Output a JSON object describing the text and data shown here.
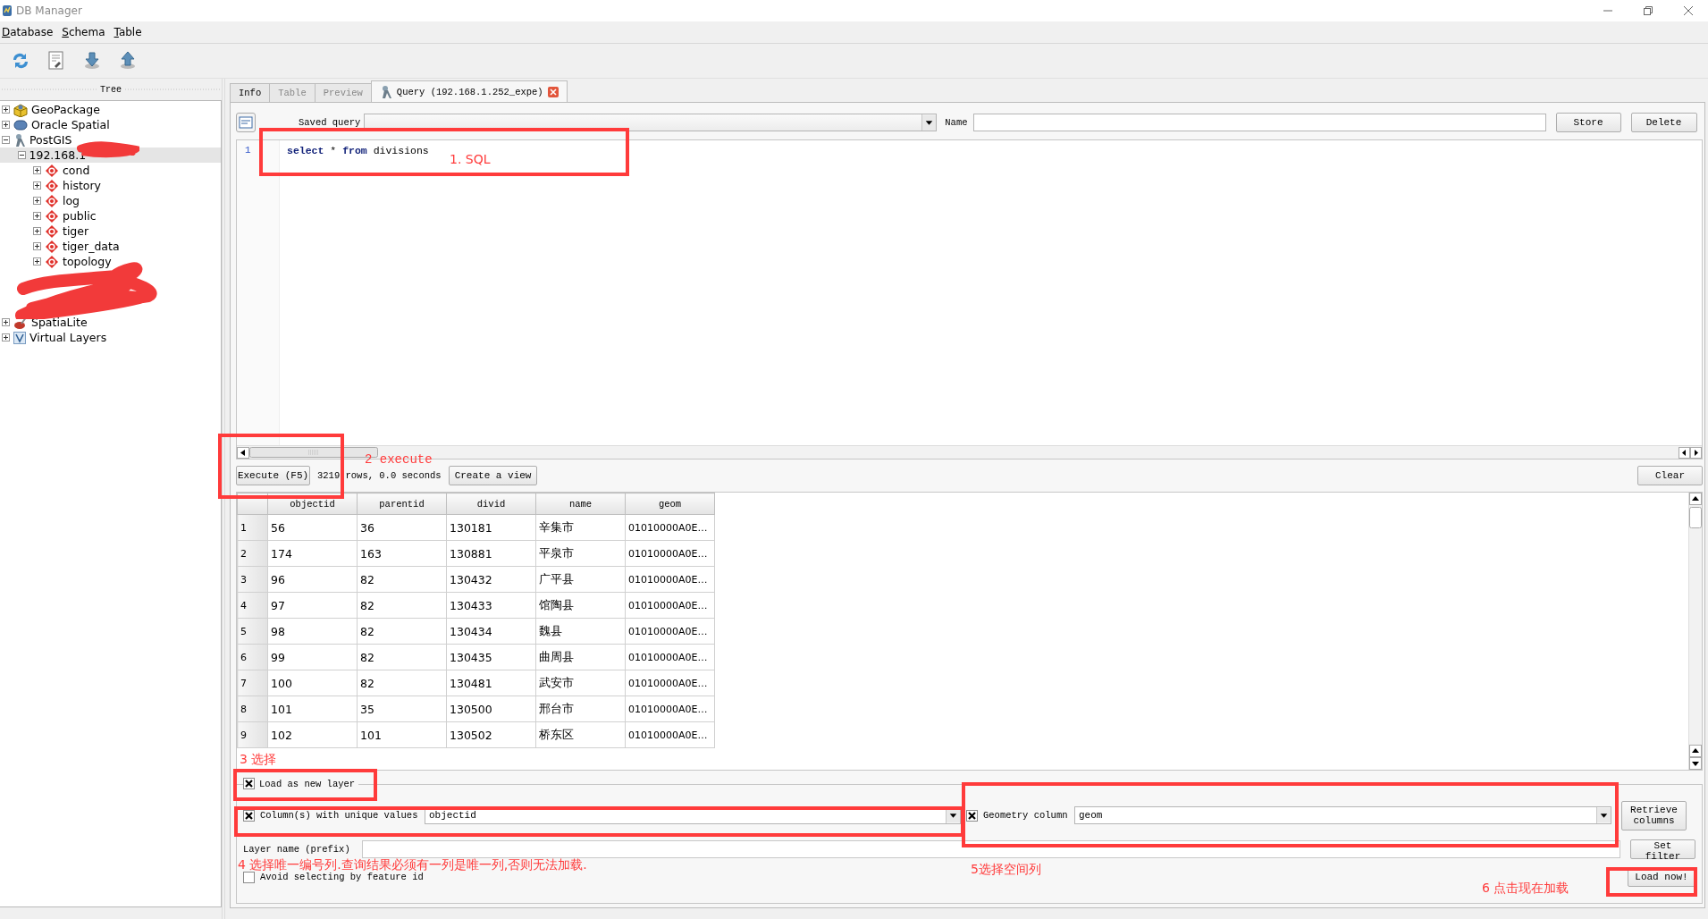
{
  "window": {
    "title": "DB Manager"
  },
  "menu": [
    {
      "label": "Database"
    },
    {
      "label": "Schema"
    },
    {
      "label": "Table"
    }
  ],
  "tree": {
    "title": "Tree",
    "items": [
      {
        "label": "GeoPackage",
        "kind": "geopackage",
        "expanded": false,
        "selected": false
      },
      {
        "label": "Oracle Spatial",
        "kind": "oracle",
        "expanded": false,
        "selected": false
      },
      {
        "label": "PostGIS",
        "kind": "postgis",
        "expanded": true,
        "selected": false,
        "children": [
          {
            "label": "192.168.1",
            "expanded": true,
            "selected": true,
            "children": [
              {
                "label": "cond",
                "kind": "schema",
                "expanded": false,
                "selected": false
              },
              {
                "label": "history",
                "kind": "schema",
                "expanded": false,
                "selected": false
              },
              {
                "label": "log",
                "kind": "schema",
                "expanded": false,
                "selected": false
              },
              {
                "label": "public",
                "kind": "schema",
                "expanded": false,
                "selected": false
              },
              {
                "label": "tiger",
                "kind": "schema",
                "expanded": false,
                "selected": false
              },
              {
                "label": "tiger_data",
                "kind": "schema",
                "expanded": false,
                "selected": false
              },
              {
                "label": "topology",
                "kind": "schema",
                "expanded": false,
                "selected": false
              }
            ]
          }
        ]
      },
      {
        "label": "SpatiaLite",
        "kind": "spatialite",
        "expanded": false,
        "selected": false
      },
      {
        "label": "Virtual Layers",
        "kind": "virtual",
        "expanded": false,
        "selected": false
      }
    ]
  },
  "tabs": [
    {
      "label": "Info",
      "selected": false,
      "disabled": false,
      "closable": false
    },
    {
      "label": "Table",
      "selected": false,
      "disabled": true,
      "closable": false
    },
    {
      "label": "Preview",
      "selected": false,
      "disabled": true,
      "closable": false
    },
    {
      "label": "Query (192.168.1.252_expe)",
      "selected": true,
      "disabled": false,
      "closable": true
    }
  ],
  "query": {
    "saved_query_label": "Saved query",
    "name_label": "Name",
    "store_button": "Store",
    "delete_button": "Delete",
    "lines": [
      {
        "number": "1",
        "code": "**select** * **from** divisions"
      }
    ]
  },
  "execute": {
    "execute_button": "Execute (F5)",
    "status": "3219 rows, 0.0 seconds",
    "view_button": "Create a view",
    "clear_button": "Clear"
  },
  "results": {
    "columns": [
      "objectid",
      "parentid",
      "divid",
      "name",
      "geom"
    ],
    "rows": [
      {
        "number": "1",
        "cells": [
          "56",
          "36",
          "130181",
          "辛集市",
          "01010000A0E…"
        ]
      },
      {
        "number": "2",
        "cells": [
          "174",
          "163",
          "130881",
          "平泉市",
          "01010000A0E…"
        ]
      },
      {
        "number": "3",
        "cells": [
          "96",
          "82",
          "130432",
          "广平县",
          "01010000A0E…"
        ]
      },
      {
        "number": "4",
        "cells": [
          "97",
          "82",
          "130433",
          "馆陶县",
          "01010000A0E…"
        ]
      },
      {
        "number": "5",
        "cells": [
          "98",
          "82",
          "130434",
          "魏县",
          "01010000A0E…"
        ]
      },
      {
        "number": "6",
        "cells": [
          "99",
          "82",
          "130435",
          "曲周县",
          "01010000A0E…"
        ]
      },
      {
        "number": "7",
        "cells": [
          "100",
          "82",
          "130481",
          "武安市",
          "01010000A0E…"
        ]
      },
      {
        "number": "8",
        "cells": [
          "101",
          "35",
          "130500",
          "邢台市",
          "01010000A0E…"
        ]
      },
      {
        "number": "9",
        "cells": [
          "102",
          "101",
          "130502",
          "桥东区",
          "01010000A0E…"
        ]
      }
    ]
  },
  "load": {
    "load_as_layer": {
      "label": "Load as new layer",
      "checked": true
    },
    "unique": {
      "label": "Column(s) with unique values",
      "checked": true,
      "value": "objectid"
    },
    "geometry": {
      "label": "Geometry column",
      "checked": true,
      "value": "geom"
    },
    "layer_name": {
      "label": "Layer name (prefix)"
    },
    "avoid": {
      "label": "Avoid selecting by feature id",
      "checked": false
    },
    "retrieve_button": "Retrieve columns",
    "set_filter_button": "Set filter",
    "load_now_button": "Load now!"
  },
  "annotations": [
    {
      "text": "1. SQL"
    },
    {
      "text": "2 execute"
    },
    {
      "text": "3 选择"
    },
    {
      "text": "4  选择唯一编号列.查询结果必须有一列是唯一列,否则无法加载."
    },
    {
      "text": "5选择空间列"
    },
    {
      "text": "6 点击现在加载"
    }
  ]
}
